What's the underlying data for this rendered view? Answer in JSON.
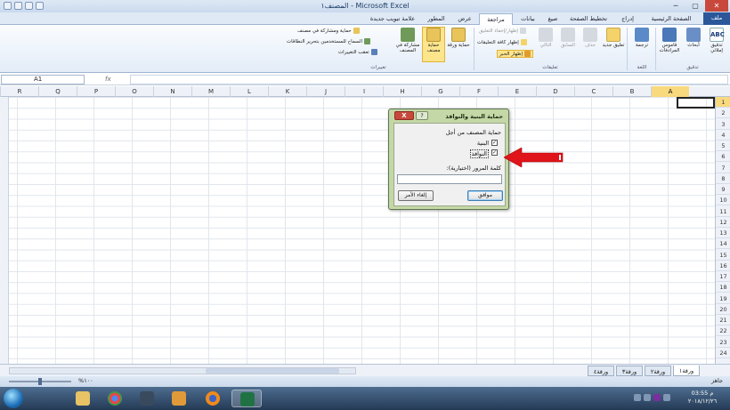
{
  "window": {
    "title": "المصنف١ - Microsoft Excel",
    "controls": [
      "─",
      "▢",
      "✕"
    ]
  },
  "ribbon_tabs": [
    {
      "label": "ملف",
      "active": false,
      "file": true
    },
    {
      "label": "الصفحة الرئيسية",
      "active": false
    },
    {
      "label": "إدراج",
      "active": false
    },
    {
      "label": "تخطيط الصفحة",
      "active": false
    },
    {
      "label": "صيغ",
      "active": false
    },
    {
      "label": "بيانات",
      "active": false
    },
    {
      "label": "مراجعة",
      "active": true
    },
    {
      "label": "عرض",
      "active": false
    },
    {
      "label": "المطور",
      "active": false
    },
    {
      "label": "علامة تبويب جديدة",
      "active": false
    }
  ],
  "ribbon": {
    "proofing": {
      "spelling": "تدقيق إملائي",
      "research": "أبحاث",
      "thesaurus": "قاموس المرادفات",
      "group": "تدقيق"
    },
    "language": {
      "translate": "ترجمة",
      "group": "اللغة"
    },
    "comments": {
      "new_comment": "تعليق جديد",
      "delete": "حذف",
      "previous": "السابق",
      "next": "التالي",
      "show_hide": "إظهار/إخفاء التعليق",
      "show_all": "إظهار كافة التعليقات",
      "show_ink": "إظهار الحبر",
      "group": "تعليقات"
    },
    "changes": {
      "protect_sheet": "حماية ورقة",
      "protect_workbook": "حماية مصنف",
      "share_workbook": "مشاركة في المصنف",
      "protect_share": "حماية ومشاركة في مصنف",
      "allow_edit_ranges": "السماح للمستخدمين بتحرير النطاقات",
      "track_changes": "تعقب التغييرات",
      "group": "تغييرات"
    }
  },
  "formula_bar": {
    "name_box": "A1",
    "fx": "fx",
    "value": ""
  },
  "columns": [
    "R",
    "Q",
    "P",
    "O",
    "N",
    "M",
    "L",
    "K",
    "J",
    "I",
    "H",
    "G",
    "F",
    "E",
    "D",
    "C",
    "B",
    "A"
  ],
  "selected_column": "A",
  "rows": [
    "1",
    "2",
    "3",
    "4",
    "5",
    "6",
    "7",
    "8",
    "9",
    "10",
    "11",
    "12",
    "13",
    "14",
    "15",
    "16",
    "17",
    "18",
    "19",
    "20",
    "21",
    "22",
    "23",
    "24"
  ],
  "selected_row": "1",
  "sheets": [
    {
      "label": "ورقة١",
      "active": true
    },
    {
      "label": "ورقة٢",
      "active": false
    },
    {
      "label": "ورقة٣",
      "active": false
    },
    {
      "label": "ورقة٤",
      "active": false
    }
  ],
  "status": {
    "ready": "جاهز",
    "zoom": "%١٠٠"
  },
  "dialog": {
    "title": "حماية البنية والنوافذ",
    "help": "?",
    "close": "X",
    "section_label": "حماية المصنف من أجل",
    "structure_label": "البنية",
    "structure_checked": true,
    "windows_label": "النوافذ",
    "windows_checked": true,
    "password_label": "كلمة المرور (اختيارية):",
    "password_value": "",
    "ok_label": "موافق",
    "cancel_label": "إلغاء الأمر"
  },
  "taskbar": {
    "clock_time": "03:55 م",
    "clock_date": "٢٠١٨/١٢/٢٦",
    "apps": [
      "explorer",
      "chrome",
      "nox",
      "media-player",
      "firefox",
      "excel"
    ]
  },
  "colors": {
    "accent": "#2b579a",
    "dialog_frame": "#c4d7a6",
    "arrow": "#e0141b",
    "highlight": "#fde58c"
  }
}
